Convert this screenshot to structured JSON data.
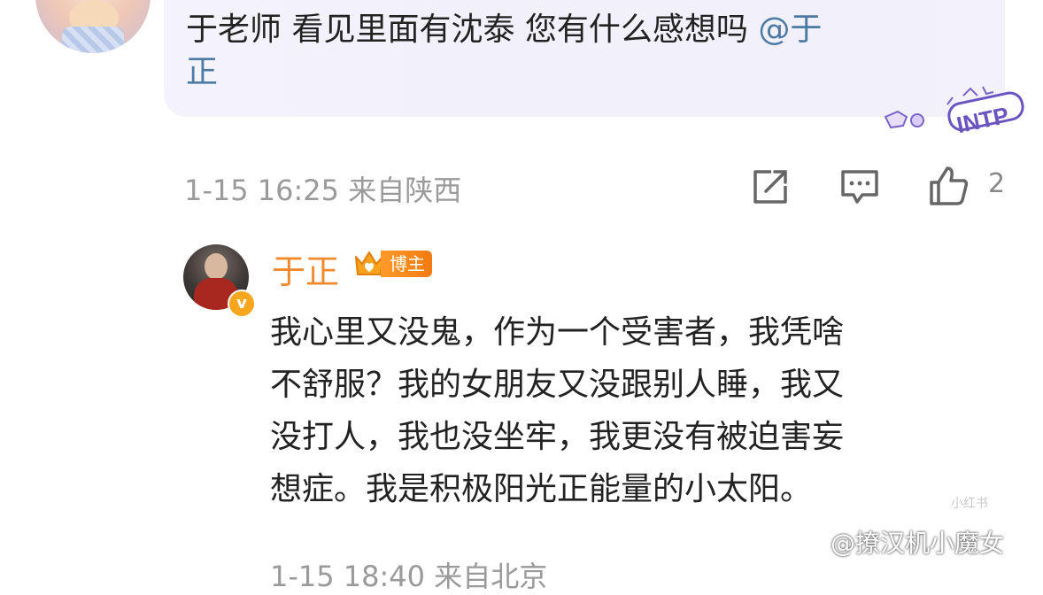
{
  "comment": {
    "text_line1_pre": "于老师  看见里面有沈泰  您有什么感想吗 ",
    "mention_line1": "@于",
    "mention_line2": "正",
    "badge_text": "INTP"
  },
  "comment_meta": {
    "time_location": "1-15 16:25 来自陕西",
    "like_count": "2"
  },
  "reply": {
    "author_name": "于正",
    "badge_label": "博主",
    "verified_mark": "v",
    "lines": [
      "我心里又没鬼，作为一个受害者，我凭啥",
      "不舒服？我的女朋友又没跟别人睡，我又",
      "没打人，我也没坐牢，我更没有被迫害妄",
      "想症。我是积极阳光正能量的小太阳。"
    ]
  },
  "reply_meta": {
    "time_location": "1-15 18:40 来自北京"
  },
  "watermarks": {
    "small": "小红书",
    "main": "@撩汉机小魔女"
  },
  "icons": [
    "share-icon",
    "comment-icon",
    "like-icon",
    "crown-icon"
  ]
}
